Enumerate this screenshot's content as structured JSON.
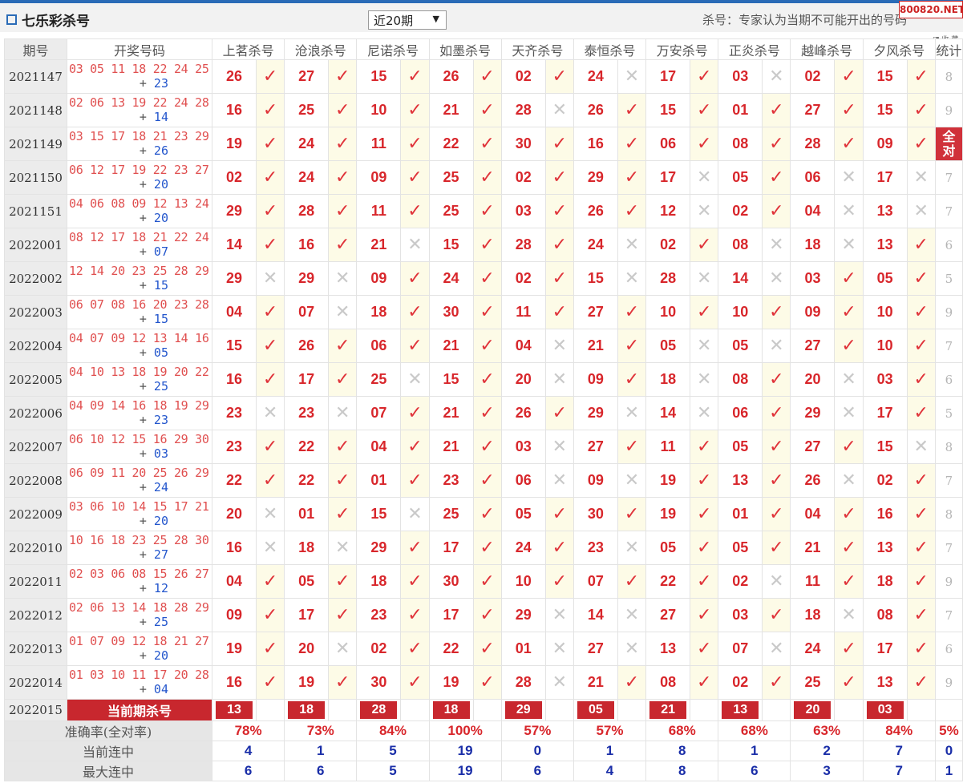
{
  "header": {
    "title": "七乐彩杀号",
    "period_select": "近20期",
    "note": "杀号：专家认为当期不可能开出的号码",
    "watermark": "800820.NET",
    "mini_icons": "◨ 收 藏"
  },
  "columns": {
    "period": "期号",
    "draw": "开奖号码",
    "experts": [
      "上茗杀号",
      "沧浪杀号",
      "尼诺杀号",
      "如墨杀号",
      "天齐杀号",
      "泰恒杀号",
      "万安杀号",
      "正炎杀号",
      "越峰杀号",
      "夕风杀号"
    ],
    "stat": "统计"
  },
  "rows": [
    {
      "period": "2021147",
      "draw": "03 05 11 18 22 24 25",
      "bonus": "23",
      "kills": [
        "26",
        "27",
        "15",
        "26",
        "02",
        "24",
        "17",
        "03",
        "02",
        "15"
      ],
      "marks": [
        1,
        1,
        1,
        1,
        1,
        0,
        1,
        0,
        1,
        1
      ],
      "stat": "8"
    },
    {
      "period": "2021148",
      "draw": "02 06 13 19 22 24 28",
      "bonus": "14",
      "kills": [
        "16",
        "25",
        "10",
        "21",
        "28",
        "26",
        "15",
        "01",
        "27",
        "15"
      ],
      "marks": [
        1,
        1,
        1,
        1,
        0,
        1,
        1,
        1,
        1,
        1
      ],
      "stat": "9"
    },
    {
      "period": "2021149",
      "draw": "03 15 17 18 21 23 29",
      "bonus": "26",
      "kills": [
        "19",
        "24",
        "11",
        "22",
        "30",
        "16",
        "06",
        "08",
        "28",
        "09"
      ],
      "marks": [
        1,
        1,
        1,
        1,
        1,
        1,
        1,
        1,
        1,
        1
      ],
      "stat": "全对"
    },
    {
      "period": "2021150",
      "draw": "06 12 17 19 22 23 27",
      "bonus": "20",
      "kills": [
        "02",
        "24",
        "09",
        "25",
        "02",
        "29",
        "17",
        "05",
        "06",
        "17"
      ],
      "marks": [
        1,
        1,
        1,
        1,
        1,
        1,
        0,
        1,
        0,
        0
      ],
      "stat": "7"
    },
    {
      "period": "2021151",
      "draw": "04 06 08 09 12 13 24",
      "bonus": "20",
      "kills": [
        "29",
        "28",
        "11",
        "25",
        "03",
        "26",
        "12",
        "02",
        "04",
        "13"
      ],
      "marks": [
        1,
        1,
        1,
        1,
        1,
        1,
        0,
        1,
        0,
        0
      ],
      "stat": "7"
    },
    {
      "period": "2022001",
      "draw": "08 12 17 18 21 22 24",
      "bonus": "07",
      "kills": [
        "14",
        "16",
        "21",
        "15",
        "28",
        "24",
        "02",
        "08",
        "18",
        "13"
      ],
      "marks": [
        1,
        1,
        0,
        1,
        1,
        0,
        1,
        0,
        0,
        1
      ],
      "stat": "6"
    },
    {
      "period": "2022002",
      "draw": "12 14 20 23 25 28 29",
      "bonus": "15",
      "kills": [
        "29",
        "29",
        "09",
        "24",
        "02",
        "15",
        "28",
        "14",
        "03",
        "05"
      ],
      "marks": [
        0,
        0,
        1,
        1,
        1,
        0,
        0,
        0,
        1,
        1
      ],
      "stat": "5"
    },
    {
      "period": "2022003",
      "draw": "06 07 08 16 20 23 28",
      "bonus": "15",
      "kills": [
        "04",
        "07",
        "18",
        "30",
        "11",
        "27",
        "10",
        "10",
        "09",
        "10"
      ],
      "marks": [
        1,
        0,
        1,
        1,
        1,
        1,
        1,
        1,
        1,
        1
      ],
      "stat": "9"
    },
    {
      "period": "2022004",
      "draw": "04 07 09 12 13 14 16",
      "bonus": "05",
      "kills": [
        "15",
        "26",
        "06",
        "21",
        "04",
        "21",
        "05",
        "05",
        "27",
        "10"
      ],
      "marks": [
        1,
        1,
        1,
        1,
        0,
        1,
        0,
        0,
        1,
        1
      ],
      "stat": "7"
    },
    {
      "period": "2022005",
      "draw": "04 10 13 18 19 20 22",
      "bonus": "25",
      "kills": [
        "16",
        "17",
        "25",
        "15",
        "20",
        "09",
        "18",
        "08",
        "20",
        "03"
      ],
      "marks": [
        1,
        1,
        0,
        1,
        0,
        1,
        0,
        1,
        0,
        1
      ],
      "stat": "6"
    },
    {
      "period": "2022006",
      "draw": "04 09 14 16 18 19 29",
      "bonus": "23",
      "kills": [
        "23",
        "23",
        "07",
        "21",
        "26",
        "29",
        "14",
        "06",
        "29",
        "17"
      ],
      "marks": [
        0,
        0,
        1,
        1,
        1,
        0,
        0,
        1,
        0,
        1
      ],
      "stat": "5"
    },
    {
      "period": "2022007",
      "draw": "06 10 12 15 16 29 30",
      "bonus": "03",
      "kills": [
        "23",
        "22",
        "04",
        "21",
        "03",
        "27",
        "11",
        "05",
        "27",
        "15"
      ],
      "marks": [
        1,
        1,
        1,
        1,
        0,
        1,
        1,
        1,
        1,
        0
      ],
      "stat": "8"
    },
    {
      "period": "2022008",
      "draw": "06 09 11 20 25 26 29",
      "bonus": "24",
      "kills": [
        "22",
        "22",
        "01",
        "23",
        "06",
        "09",
        "19",
        "13",
        "26",
        "02"
      ],
      "marks": [
        1,
        1,
        1,
        1,
        0,
        0,
        1,
        1,
        0,
        1
      ],
      "stat": "7"
    },
    {
      "period": "2022009",
      "draw": "03 06 10 14 15 17 21",
      "bonus": "20",
      "kills": [
        "20",
        "01",
        "15",
        "25",
        "05",
        "30",
        "19",
        "01",
        "04",
        "16"
      ],
      "marks": [
        0,
        1,
        0,
        1,
        1,
        1,
        1,
        1,
        1,
        1
      ],
      "stat": "8"
    },
    {
      "period": "2022010",
      "draw": "10 16 18 23 25 28 30",
      "bonus": "27",
      "kills": [
        "16",
        "18",
        "29",
        "17",
        "24",
        "23",
        "05",
        "05",
        "21",
        "13"
      ],
      "marks": [
        0,
        0,
        1,
        1,
        1,
        0,
        1,
        1,
        1,
        1
      ],
      "stat": "7"
    },
    {
      "period": "2022011",
      "draw": "02 03 06 08 15 26 27",
      "bonus": "12",
      "kills": [
        "04",
        "05",
        "18",
        "30",
        "10",
        "07",
        "22",
        "02",
        "11",
        "18"
      ],
      "marks": [
        1,
        1,
        1,
        1,
        1,
        1,
        1,
        0,
        1,
        1
      ],
      "stat": "9"
    },
    {
      "period": "2022012",
      "draw": "02 06 13 14 18 28 29",
      "bonus": "25",
      "kills": [
        "09",
        "17",
        "23",
        "17",
        "29",
        "14",
        "27",
        "03",
        "18",
        "08"
      ],
      "marks": [
        1,
        1,
        1,
        1,
        0,
        0,
        1,
        1,
        0,
        1
      ],
      "stat": "7"
    },
    {
      "period": "2022013",
      "draw": "01 07 09 12 18 21 27",
      "bonus": "20",
      "kills": [
        "19",
        "20",
        "02",
        "22",
        "01",
        "27",
        "13",
        "07",
        "24",
        "17"
      ],
      "marks": [
        1,
        0,
        1,
        1,
        0,
        0,
        1,
        0,
        1,
        1
      ],
      "stat": "6"
    },
    {
      "period": "2022014",
      "draw": "01 03 10 11 17 20 28",
      "bonus": "04",
      "kills": [
        "16",
        "19",
        "30",
        "19",
        "28",
        "21",
        "08",
        "02",
        "25",
        "13"
      ],
      "marks": [
        1,
        1,
        1,
        1,
        0,
        1,
        1,
        1,
        1,
        1
      ],
      "stat": "9"
    }
  ],
  "current": {
    "period": "2022015",
    "label": "当前期杀号",
    "kills": [
      "13",
      "18",
      "28",
      "18",
      "29",
      "05",
      "21",
      "13",
      "20",
      "03"
    ]
  },
  "stats": {
    "accuracy_label": "准确率(全对率)",
    "accuracy": [
      "78%",
      "73%",
      "84%",
      "100%",
      "57%",
      "57%",
      "68%",
      "68%",
      "63%",
      "84%"
    ],
    "accuracy_total": "5%",
    "current_streak_label": "当前连中",
    "current_streak": [
      "4",
      "1",
      "5",
      "19",
      "0",
      "1",
      "8",
      "1",
      "2",
      "7"
    ],
    "current_streak_total": "0",
    "max_streak_label": "最大连中",
    "max_streak": [
      "6",
      "6",
      "5",
      "19",
      "6",
      "4",
      "8",
      "6",
      "3",
      "7"
    ],
    "max_streak_total": "1"
  },
  "colors": {
    "accent_red": "#c8272e",
    "number_red": "#d8262b",
    "bonus_blue": "#2255cc",
    "stat_blue": "#1a2ea8",
    "hit_bg": "#fdfbe7"
  },
  "icons": {
    "hit": "check-icon",
    "miss": "cross-icon"
  }
}
